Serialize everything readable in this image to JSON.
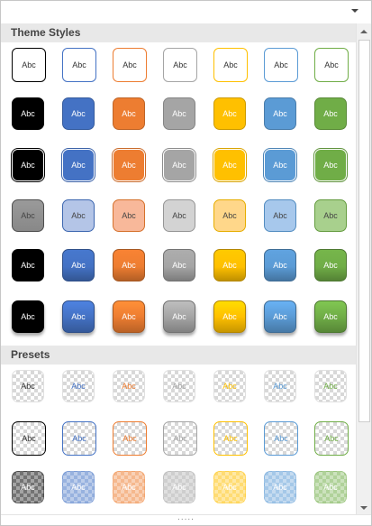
{
  "sections": [
    {
      "title": "Theme Styles",
      "rows": [
        {
          "style": "outline",
          "items": [
            {
              "label": "Abc",
              "color": "#000000",
              "bg": "#ffffff"
            },
            {
              "label": "Abc",
              "color": "#4472c4",
              "bg": "#ffffff"
            },
            {
              "label": "Abc",
              "color": "#ed7d31",
              "bg": "#ffffff"
            },
            {
              "label": "Abc",
              "color": "#a5a5a5",
              "bg": "#ffffff"
            },
            {
              "label": "Abc",
              "color": "#ffc000",
              "bg": "#ffffff"
            },
            {
              "label": "Abc",
              "color": "#5b9bd5",
              "bg": "#ffffff"
            },
            {
              "label": "Abc",
              "color": "#70ad47",
              "bg": "#ffffff"
            }
          ]
        },
        {
          "style": "solid",
          "items": [
            {
              "label": "Abc",
              "color": "#000000",
              "bg": "#000000"
            },
            {
              "label": "Abc",
              "color": "#4472c4",
              "bg": "#4472c4"
            },
            {
              "label": "Abc",
              "color": "#ed7d31",
              "bg": "#ed7d31"
            },
            {
              "label": "Abc",
              "color": "#a5a5a5",
              "bg": "#a5a5a5"
            },
            {
              "label": "Abc",
              "color": "#ffc000",
              "bg": "#ffc000"
            },
            {
              "label": "Abc",
              "color": "#5b9bd5",
              "bg": "#5b9bd5"
            },
            {
              "label": "Abc",
              "color": "#70ad47",
              "bg": "#70ad47"
            }
          ]
        },
        {
          "style": "solid-white-border",
          "items": [
            {
              "label": "Abc",
              "color": "#000000",
              "bg": "#000000"
            },
            {
              "label": "Abc",
              "color": "#4472c4",
              "bg": "#4472c4"
            },
            {
              "label": "Abc",
              "color": "#ed7d31",
              "bg": "#ed7d31"
            },
            {
              "label": "Abc",
              "color": "#a5a5a5",
              "bg": "#a5a5a5"
            },
            {
              "label": "Abc",
              "color": "#ffc000",
              "bg": "#ffc000"
            },
            {
              "label": "Abc",
              "color": "#5b9bd5",
              "bg": "#5b9bd5"
            },
            {
              "label": "Abc",
              "color": "#70ad47",
              "bg": "#70ad47"
            }
          ]
        },
        {
          "style": "light",
          "items": [
            {
              "label": "Abc",
              "color": "#555555",
              "bg": "#888888"
            },
            {
              "label": "Abc",
              "color": "#4472c4",
              "bg": "#b4c5e7"
            },
            {
              "label": "Abc",
              "color": "#ed7d31",
              "bg": "#f8b89a"
            },
            {
              "label": "Abc",
              "color": "#a5a5a5",
              "bg": "#d3d3d3"
            },
            {
              "label": "Abc",
              "color": "#ffc000",
              "bg": "#ffd78a"
            },
            {
              "label": "Abc",
              "color": "#5b9bd5",
              "bg": "#a7c8ec"
            },
            {
              "label": "Abc",
              "color": "#70ad47",
              "bg": "#a8d08d"
            }
          ]
        },
        {
          "style": "gradient",
          "items": [
            {
              "label": "Abc",
              "color": "#000000",
              "bg": "#000000"
            },
            {
              "label": "Abc",
              "color": "#4472c4",
              "bg": "#4472c4"
            },
            {
              "label": "Abc",
              "color": "#ed7d31",
              "bg": "#ed7d31"
            },
            {
              "label": "Abc",
              "color": "#a5a5a5",
              "bg": "#a5a5a5"
            },
            {
              "label": "Abc",
              "color": "#ffc000",
              "bg": "#ffc000"
            },
            {
              "label": "Abc",
              "color": "#5b9bd5",
              "bg": "#5b9bd5"
            },
            {
              "label": "Abc",
              "color": "#70ad47",
              "bg": "#70ad47"
            }
          ]
        },
        {
          "style": "intense",
          "items": [
            {
              "label": "Abc",
              "color": "#000000",
              "bg": "#000000"
            },
            {
              "label": "Abc",
              "color": "#4472c4",
              "bg": "#4472c4"
            },
            {
              "label": "Abc",
              "color": "#ed7d31",
              "bg": "#ed7d31"
            },
            {
              "label": "Abc",
              "color": "#a5a5a5",
              "bg": "#a5a5a5"
            },
            {
              "label": "Abc",
              "color": "#ffc000",
              "bg": "#ffc000"
            },
            {
              "label": "Abc",
              "color": "#5b9bd5",
              "bg": "#5b9bd5"
            },
            {
              "label": "Abc",
              "color": "#70ad47",
              "bg": "#70ad47"
            }
          ]
        }
      ]
    },
    {
      "title": "Presets",
      "rows": [
        {
          "style": "preset-transparent",
          "items": [
            {
              "label": "Abc",
              "color": "#000000",
              "bg": "#000000"
            },
            {
              "label": "Abc",
              "color": "#4472c4",
              "bg": "#4472c4"
            },
            {
              "label": "Abc",
              "color": "#ed7d31",
              "bg": "#ed7d31"
            },
            {
              "label": "Abc",
              "color": "#a5a5a5",
              "bg": "#a5a5a5"
            },
            {
              "label": "Abc",
              "color": "#ffc000",
              "bg": "#ffc000"
            },
            {
              "label": "Abc",
              "color": "#5b9bd5",
              "bg": "#5b9bd5"
            },
            {
              "label": "Abc",
              "color": "#70ad47",
              "bg": "#70ad47"
            }
          ]
        },
        {
          "style": "preset-outline",
          "items": [
            {
              "label": "Abc",
              "color": "#000000",
              "bg": "#000000"
            },
            {
              "label": "Abc",
              "color": "#4472c4",
              "bg": "#4472c4"
            },
            {
              "label": "Abc",
              "color": "#ed7d31",
              "bg": "#ed7d31"
            },
            {
              "label": "Abc",
              "color": "#a5a5a5",
              "bg": "#a5a5a5"
            },
            {
              "label": "Abc",
              "color": "#ffc000",
              "bg": "#ffc000"
            },
            {
              "label": "Abc",
              "color": "#5b9bd5",
              "bg": "#5b9bd5"
            },
            {
              "label": "Abc",
              "color": "#70ad47",
              "bg": "#70ad47"
            }
          ]
        },
        {
          "style": "preset-semi",
          "items": [
            {
              "label": "Abc",
              "color": "#000000",
              "bg": "#000000"
            },
            {
              "label": "Abc",
              "color": "#4472c4",
              "bg": "#4472c4"
            },
            {
              "label": "Abc",
              "color": "#ed7d31",
              "bg": "#ed7d31"
            },
            {
              "label": "Abc",
              "color": "#a5a5a5",
              "bg": "#a5a5a5"
            },
            {
              "label": "Abc",
              "color": "#ffc000",
              "bg": "#ffc000"
            },
            {
              "label": "Abc",
              "color": "#5b9bd5",
              "bg": "#5b9bd5"
            },
            {
              "label": "Abc",
              "color": "#70ad47",
              "bg": "#70ad47"
            }
          ]
        }
      ]
    }
  ],
  "resize_grip": "....."
}
